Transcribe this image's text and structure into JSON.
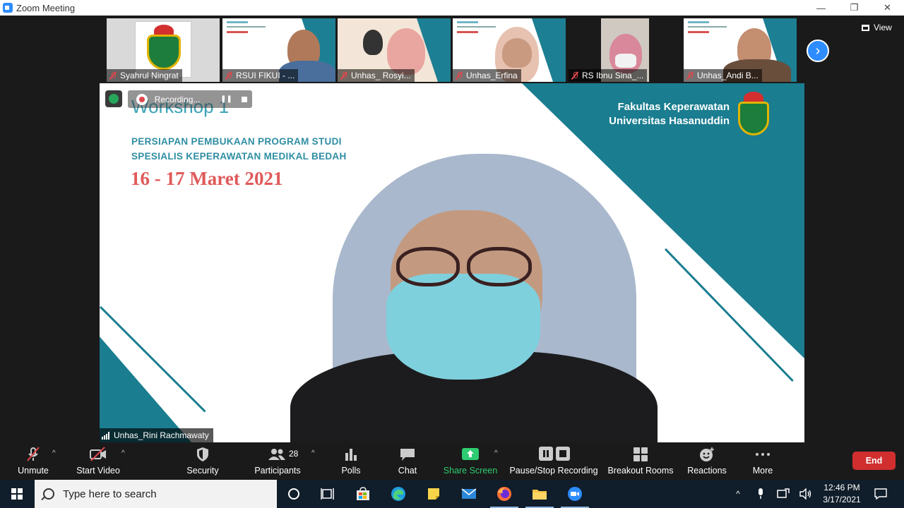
{
  "window": {
    "title": "Zoom Meeting",
    "controls": [
      "—",
      "❐",
      "✕"
    ]
  },
  "thumbnails": [
    {
      "name": "Syahrul Ningrat",
      "muted": true
    },
    {
      "name": "RSUI FIKUI - ...",
      "muted": true
    },
    {
      "name": "Unhas_ Rosyi...",
      "muted": true
    },
    {
      "name": "Unhas_Erfina",
      "muted": true
    },
    {
      "name": "RS Ibnu Sina_...",
      "muted": true
    },
    {
      "name": "Unhas_Andi B...",
      "muted": true
    }
  ],
  "view_label": "View",
  "slide": {
    "title": "Workshop 1",
    "subtitle_line1": "PERSIAPAN PEMBUKAAN PROGRAM STUDI",
    "subtitle_line2": "SPESIALIS KEPERAWATAN MEDIKAL BEDAH",
    "date": "16 - 17 Maret 2021",
    "org_line1": "Fakultas Keperawatan",
    "org_line2": "Universitas Hasanuddin"
  },
  "recording": {
    "label": "Recording...",
    "pause_glyph": "❚❚"
  },
  "active_speaker": "Unhas_Rini Rachmawaty",
  "toolbar": {
    "unmute": "Unmute",
    "start_video": "Start Video",
    "security": "Security",
    "participants": "Participants",
    "participants_count": "28",
    "polls": "Polls",
    "chat": "Chat",
    "share_screen": "Share Screen",
    "pause_stop_recording": "Pause/Stop Recording",
    "breakout_rooms": "Breakout Rooms",
    "reactions": "Reactions",
    "more": "More",
    "end": "End"
  },
  "taskbar": {
    "search_placeholder": "Type here to search",
    "time": "12:46 PM",
    "date": "3/17/2021"
  },
  "colors": {
    "zoom_blue": "#2d8cff",
    "slide_teal": "#1a7d90",
    "end_red": "#d12f2f",
    "share_green": "#2ecc71"
  }
}
